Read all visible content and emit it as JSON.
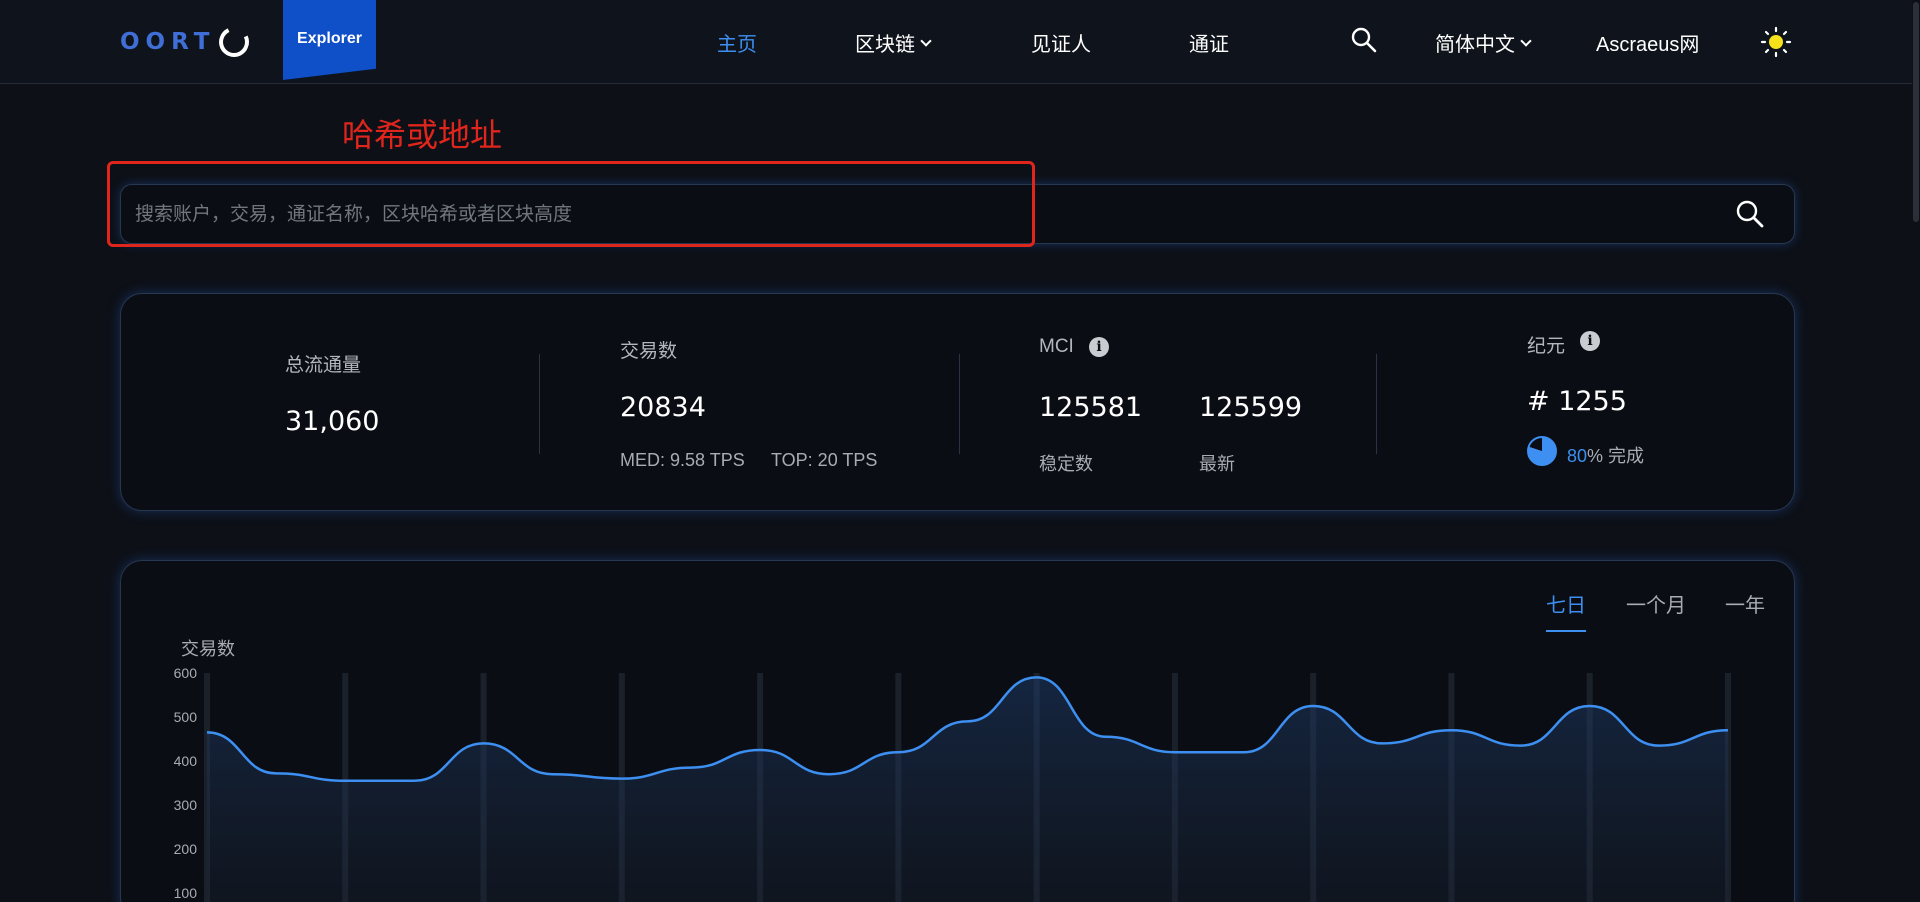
{
  "header": {
    "logo_text": "OORT",
    "explorer_label": "Explorer",
    "nav": [
      {
        "label": "主页",
        "active": true
      },
      {
        "label": "区块链",
        "dropdown": true
      },
      {
        "label": "见证人"
      },
      {
        "label": "通证"
      }
    ],
    "language": "简体中文",
    "network": "Ascraeus网",
    "search_icon": "search-icon",
    "theme_icon": "sun-icon"
  },
  "search": {
    "annotation_label": "哈希或地址",
    "placeholder": "搜索账户，交易，通证名称，区块哈希或者区块高度"
  },
  "stats": {
    "circulation_label": "总流通量",
    "circulation_value": "31,060",
    "tx_label": "交易数",
    "tx_value": "20834",
    "tx_med": "MED: 9.58 TPS",
    "tx_top": "TOP: 20 TPS",
    "mci_label": "MCI",
    "mci_stable_value": "125581",
    "mci_stable_label": "稳定数",
    "mci_latest_value": "125599",
    "mci_latest_label": "最新",
    "epoch_label": "纪元",
    "epoch_value": "# 1255",
    "epoch_percent": "80",
    "epoch_percent_suffix": "% 完成"
  },
  "chart_tabs": [
    {
      "label": "七日",
      "active": true
    },
    {
      "label": "一个月"
    },
    {
      "label": "一年"
    }
  ],
  "chart_data": {
    "type": "area",
    "ylabel": "交易数",
    "yticks": [
      600,
      500,
      400,
      300,
      200,
      100
    ],
    "ylim": [
      100,
      600
    ],
    "color": "#3d8ff1",
    "x": [
      0,
      0.5,
      1,
      1.5,
      2,
      2.5,
      3,
      3.5,
      4,
      4.5,
      5,
      5.5,
      6,
      6.5,
      7,
      7.5,
      8,
      8.5,
      9,
      9.5,
      10,
      10.5,
      11
    ],
    "values": [
      465,
      372,
      355,
      355,
      440,
      370,
      360,
      385,
      425,
      370,
      420,
      490,
      590,
      455,
      420,
      420,
      525,
      440,
      470,
      435,
      525,
      435,
      470
    ]
  },
  "colors": {
    "accent": "#3d8ff1",
    "annotation": "#e0251c",
    "background": "#0d1017"
  }
}
